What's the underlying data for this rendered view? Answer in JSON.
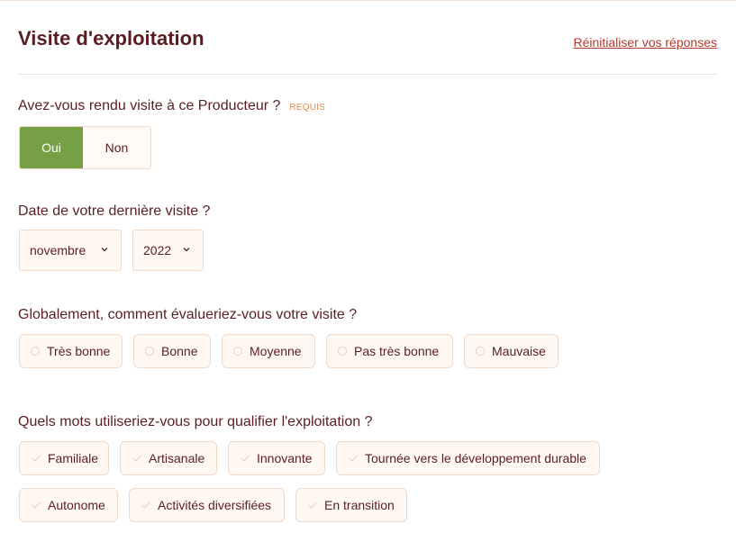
{
  "header": {
    "title": "Visite d'exploitation",
    "reset_label": "Réinitialiser vos réponses"
  },
  "q1": {
    "label": "Avez-vous rendu visite à ce Producteur ?",
    "required": "REQUIS",
    "options": [
      "Oui",
      "Non"
    ],
    "selected": "Oui"
  },
  "q2": {
    "label": "Date de votre dernière visite ?",
    "month": "novembre",
    "year": "2022"
  },
  "q3": {
    "label": "Globalement, comment évalueriez-vous votre visite ?",
    "options": [
      "Très bonne",
      "Bonne",
      "Moyenne",
      "Pas très bonne",
      "Mauvaise"
    ]
  },
  "q4": {
    "label": "Quels mots utiliseriez-vous pour qualifier l'exploitation ?",
    "options": [
      "Familiale",
      "Artisanale",
      "Innovante",
      "Tournée vers le développement durable",
      "Autonome",
      "Activités diversifiées",
      "En transition"
    ]
  },
  "colors": {
    "accent_green": "#76a046",
    "text_brown": "#5a1e22",
    "link_red": "#b23a2c",
    "required_orange": "#e08a55"
  },
  "icons": {
    "select_arrow": "chevron-down-icon",
    "radio": "radio-circle-icon",
    "check": "check-icon"
  }
}
